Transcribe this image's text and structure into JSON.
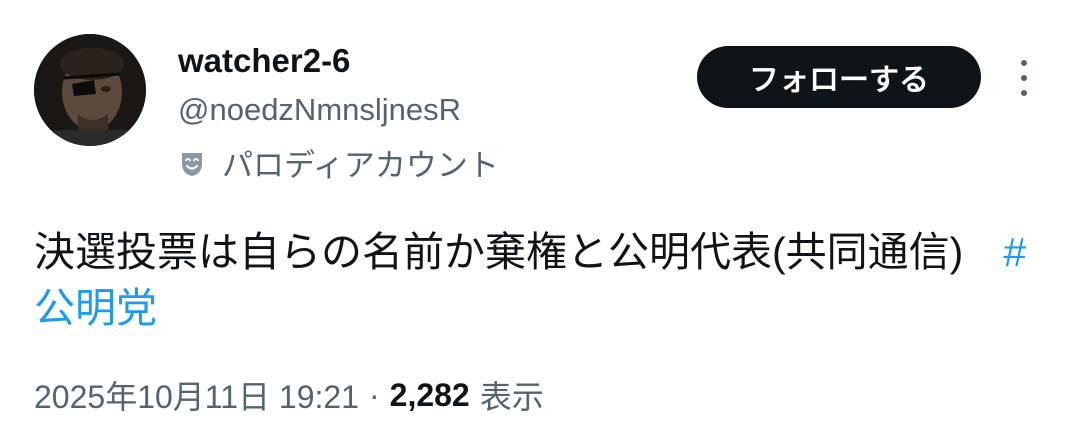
{
  "author": {
    "display_name": "watcher2-6",
    "handle": "@noedzNmnsljnesR",
    "parody_label": "パロディアカウント",
    "avatar_icon": "profile-photo",
    "parody_icon": "theater-mask-icon"
  },
  "actions": {
    "follow_label": "フォローする",
    "more_icon": "more-vertical-icon"
  },
  "tweet": {
    "text": "決選投票は自らの名前か棄権と公明代表(共同通信)",
    "hashtag": "#公明党"
  },
  "meta": {
    "timestamp": "2025年10月11日 19:21",
    "separator": "·",
    "views_count": "2,282",
    "views_label": "表示"
  },
  "colors": {
    "text": "#0f1419",
    "secondary": "#536471",
    "link": "#1d9bf0",
    "button_bg": "#0f1419",
    "button_text": "#ffffff"
  }
}
